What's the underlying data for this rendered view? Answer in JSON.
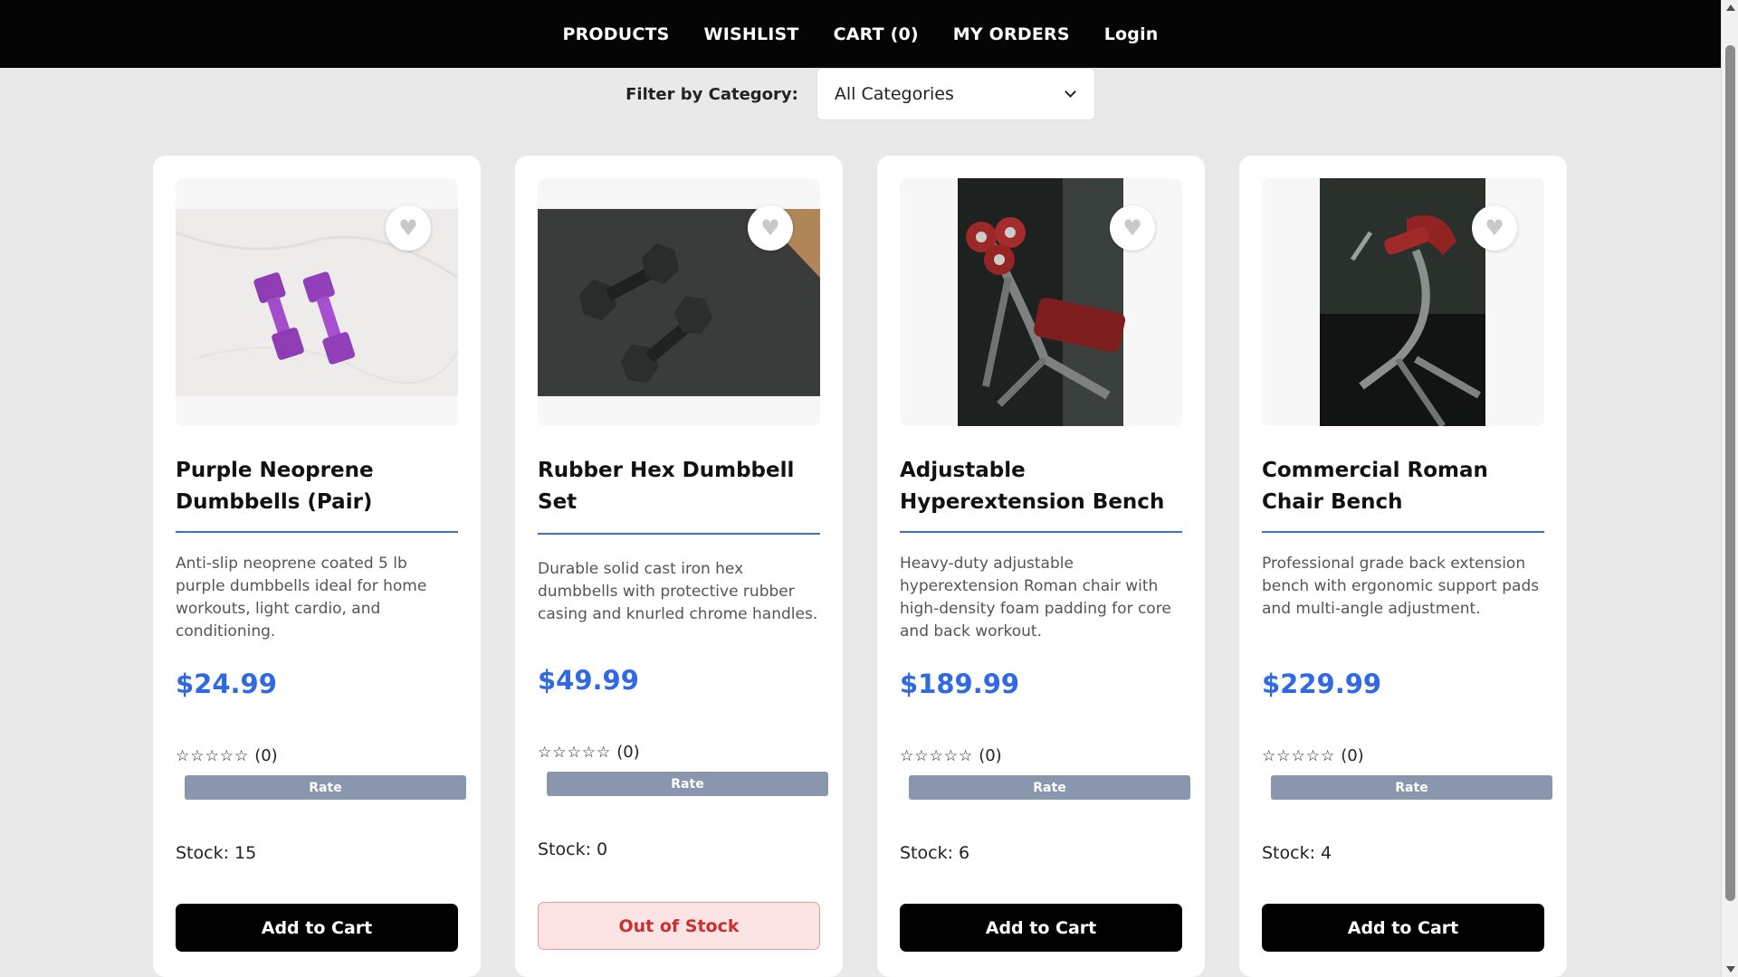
{
  "nav": {
    "products": "PRODUCTS",
    "wishlist": "WISHLIST",
    "cart": "CART (0)",
    "orders": "MY ORDERS",
    "login": "Login"
  },
  "filter": {
    "label": "Filter by Category:",
    "selected": "All Categories"
  },
  "products": [
    {
      "title": "Purple Neoprene Dumbbells (Pair)",
      "description": "Anti-slip neoprene coated 5 lb purple dumbbells ideal for home workouts, light cardio, and conditioning.",
      "price": "$24.99",
      "stars": "☆☆☆☆☆",
      "rating_count": "(0)",
      "rate_label": "Rate",
      "stock": "Stock: 15",
      "button": "Add to Cart"
    },
    {
      "title": "Rubber Hex Dumbbell Set",
      "description": "Durable solid cast iron hex dumbbells with protective rubber casing and knurled chrome handles.",
      "price": "$49.99",
      "stars": "☆☆☆☆☆",
      "rating_count": "(0)",
      "rate_label": "Rate",
      "stock": "Stock: 0",
      "button": "Out of Stock"
    },
    {
      "title": "Adjustable Hyperextension Bench",
      "description": "Heavy-duty adjustable hyperextension Roman chair with high-density foam padding for core and back workout.",
      "price": "$189.99",
      "stars": "☆☆☆☆☆",
      "rating_count": "(0)",
      "rate_label": "Rate",
      "stock": "Stock: 6",
      "button": "Add to Cart"
    },
    {
      "title": "Commercial Roman Chair Bench",
      "description": "Professional grade back extension bench with ergonomic support pads and multi-angle adjustment.",
      "price": "$229.99",
      "stars": "☆☆☆☆☆",
      "rating_count": "(0)",
      "rate_label": "Rate",
      "stock": "Stock: 4",
      "button": "Add to Cart"
    }
  ],
  "colors": {
    "nav_bg": "#050505",
    "price": "#3169e3",
    "rate_button": "#8a96ad",
    "out_of_stock_bg": "#fde4e4",
    "out_of_stock_text": "#c93030"
  },
  "icons": {
    "wishlist": "heart-icon",
    "dropdown": "chevron-down-icon"
  }
}
